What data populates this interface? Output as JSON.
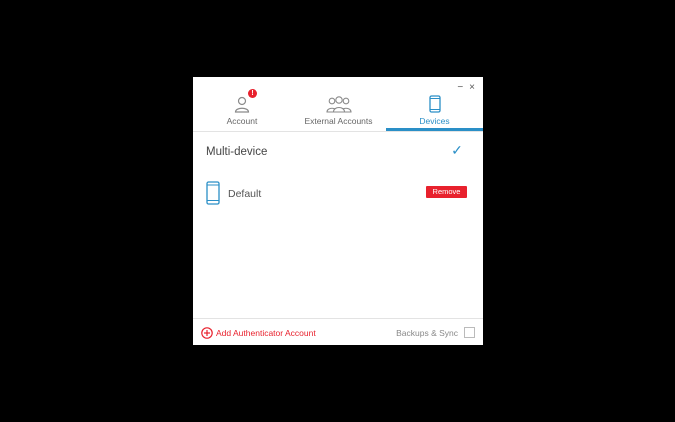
{
  "window_controls": {
    "minimize": "−",
    "close": "×"
  },
  "tabs": [
    {
      "label": "Account",
      "icon": "user-icon",
      "alert": "!"
    },
    {
      "label": "External Accounts",
      "icon": "group-icon"
    },
    {
      "label": "Devices",
      "icon": "phone-icon",
      "active": true
    }
  ],
  "multi_device": {
    "label": "Multi-device",
    "checked": true,
    "check_glyph": "✓"
  },
  "devices": [
    {
      "name": "Default",
      "icon": "phone-icon",
      "remove_label": "Remove"
    }
  ],
  "footer": {
    "add_account_label": "Add Authenticator Account",
    "backups_label": "Backups & Sync",
    "backups_checked": false
  },
  "colors": {
    "accent_blue": "#2a8fc7",
    "accent_red": "#e8212d",
    "background": "#000000"
  }
}
